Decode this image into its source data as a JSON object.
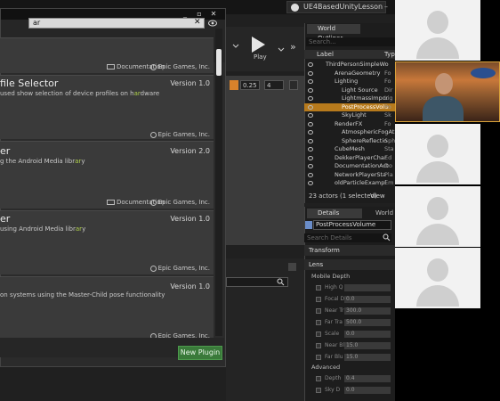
{
  "project_tab": "UE4BasedUnityLesson",
  "plugin_window": {
    "search_value": "ar",
    "top_row": {
      "doc_label": "Documentation",
      "company": "Epic Games, Inc."
    },
    "plugins": [
      {
        "name": "file Selector",
        "version": "Version 1.0",
        "desc_pre": "used show selection of device profiles on h",
        "desc_hl": "ar",
        "desc_post": "dware",
        "company": "Epic Games, Inc.",
        "doc_label": ""
      },
      {
        "name": "er",
        "version": "Version 2.0",
        "desc_pre": "g the Android Media libr",
        "desc_hl": "ar",
        "desc_post": "y",
        "company": "",
        "doc_label": "Documentation",
        "company2": "Epic Games, Inc."
      },
      {
        "name": "er",
        "version": "Version 1.0",
        "desc_pre": "using Android Media libr",
        "desc_hl": "ar",
        "desc_post": "y",
        "company": "Epic Games, Inc.",
        "doc_label": ""
      },
      {
        "name": "",
        "version": "Version 1.0",
        "desc_pre": "on systems using the Master-Child pose functionality",
        "desc_hl": "",
        "desc_post": "",
        "company": "Epic Games, Inc.",
        "doc_label": ""
      }
    ],
    "new_plugin_label": "New Plugin"
  },
  "toolbar": {
    "play_label": "Play",
    "chip1": "0.25",
    "chip2": "4"
  },
  "outliner": {
    "tab_label": "World Outliner",
    "search_placeholder": "Search...",
    "col_label": "Label",
    "col_type": "Typ",
    "rows": [
      {
        "label": "ThirdPersonSimpleWo",
        "type": ""
      },
      {
        "label": "ArenaGeometry",
        "type": "Fo"
      },
      {
        "label": "Lighting",
        "type": "Fo"
      },
      {
        "label": "Light Source",
        "type": "Dir"
      },
      {
        "label": "LightmassImpor",
        "type": "Lig"
      },
      {
        "label": "PostProcessVolu",
        "type": "Po"
      },
      {
        "label": "SkyLight",
        "type": "Sk"
      },
      {
        "label": "RenderFX",
        "type": "Fo"
      },
      {
        "label": "AtmosphericFogAt",
        "type": ""
      },
      {
        "label": "SphereReflectio",
        "type": "Sph"
      },
      {
        "label": "CubeMesh",
        "type": "Sta"
      },
      {
        "label": "DekkerPlayerChar",
        "type": "Ed"
      },
      {
        "label": "DocumentationAct",
        "type": "Do"
      },
      {
        "label": "NetworkPlayerSta",
        "type": "Pla"
      },
      {
        "label": "oldParticleExampl",
        "type": "Em"
      }
    ],
    "actors_count": "23 actors (1 selected)",
    "view_options": "View"
  },
  "details": {
    "tab_label": "Details",
    "world_tab_label": "World",
    "object_name": "PostProcessVolume",
    "search_placeholder": "Search Details",
    "sections": [
      "Transform",
      "Lens"
    ],
    "sub_mobile": "Mobile Depth",
    "props": [
      {
        "label": "High Q",
        "value": ""
      },
      {
        "label": "Focal D",
        "value": "0.0"
      },
      {
        "label": "Near Tr",
        "value": "300.0"
      },
      {
        "label": "Far Tra",
        "value": "500.0"
      },
      {
        "label": "Scale",
        "value": "0.0"
      },
      {
        "label": "Near Bl",
        "value": "15.0"
      },
      {
        "label": "Far Blu",
        "value": "15.0"
      }
    ],
    "sub_advanced": "Advanced",
    "adv_props": [
      {
        "label": "Depth",
        "value": "0.4"
      },
      {
        "label": "Sky D",
        "value": "0.0"
      }
    ]
  }
}
